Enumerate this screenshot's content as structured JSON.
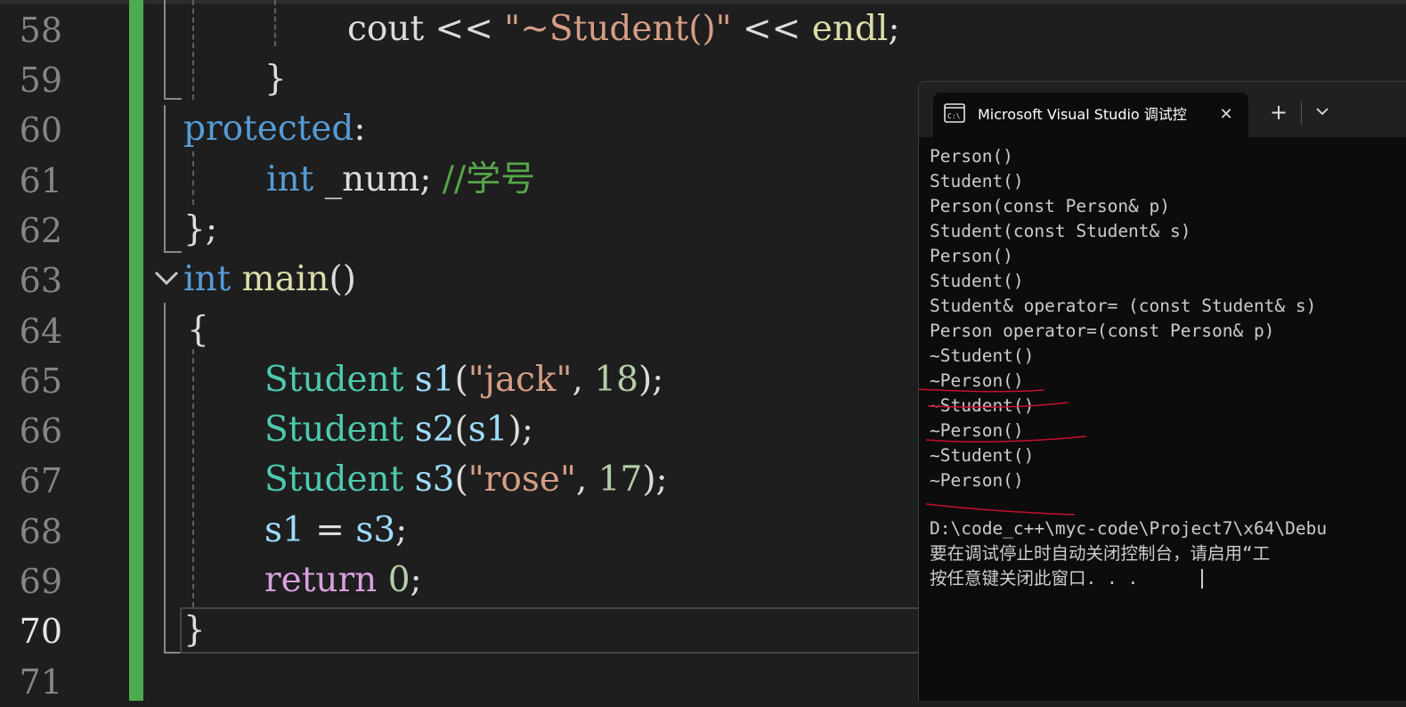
{
  "editor": {
    "line_numbers": [
      "58",
      "59",
      "60",
      "61",
      "62",
      "63",
      "64",
      "65",
      "66",
      "67",
      "68",
      "69",
      "70",
      "71"
    ],
    "current_line": "70",
    "code": {
      "l58": {
        "a": "cout",
        "b": " << ",
        "c": "\"~Student()\"",
        "d": " << ",
        "e": "endl",
        "f": ";"
      },
      "l59": {
        "a": "}"
      },
      "l60": {
        "a": "protected",
        "b": ":"
      },
      "l61": {
        "a": "int",
        "b": " _num; ",
        "c": "//学号"
      },
      "l62": {
        "a": "};"
      },
      "l63": {
        "a": "int",
        "b": " ",
        "c": "main",
        "d": "()"
      },
      "l64": {
        "a": "{"
      },
      "l65": {
        "a": "Student",
        "b": " ",
        "c": "s1",
        "d": "(",
        "e": "\"jack\"",
        "f": ", ",
        "g": "18",
        "h": ");"
      },
      "l66": {
        "a": "Student",
        "b": " ",
        "c": "s2",
        "d": "(",
        "e": "s1",
        "f": ");"
      },
      "l67": {
        "a": "Student",
        "b": " ",
        "c": "s3",
        "d": "(",
        "e": "\"rose\"",
        "f": ", ",
        "g": "17",
        "h": ");"
      },
      "l68": {
        "a": "s1",
        "b": " = ",
        "c": "s3",
        "d": ";"
      },
      "l69": {
        "a": "return",
        "b": " ",
        "c": "0",
        "d": ";"
      },
      "l70": {
        "a": "}"
      }
    }
  },
  "console": {
    "tab_title": "Microsoft Visual Studio 调试控",
    "close_glyph": "✕",
    "new_tab_glyph": "+",
    "output_lines": [
      "Person()",
      "Student()",
      "Person(const Person& p)",
      "Student(const Student& s)",
      "Person()",
      "Student()",
      "Student& operator= (const Student& s)",
      "Person operator=(const Person& p)",
      "~Student()",
      "~Person()",
      "~Student()",
      "~Person()",
      "~Student()",
      "~Person()"
    ],
    "exit_path": "D:\\code_c++\\myc-code\\Project7\\x64\\Debu",
    "hint_line": "要在调试停止时自动关闭控制台，请启用“工",
    "press_key_line": "按任意键关闭此窗口. . ."
  },
  "colors": {
    "keyword": "#569cd6",
    "type": "#4ec9b0",
    "function": "#dcdcaa",
    "variable": "#9cdcfe",
    "string": "#d69d85",
    "number": "#b5cea8",
    "comment": "#57a64a",
    "control": "#d8a0df",
    "change_bar": "#4daa50",
    "annotation_ink": "#c8102e"
  },
  "icons": [
    "chevron-down-icon",
    "console-icon",
    "close-icon",
    "plus-icon",
    "dropdown-chevron-icon"
  ]
}
